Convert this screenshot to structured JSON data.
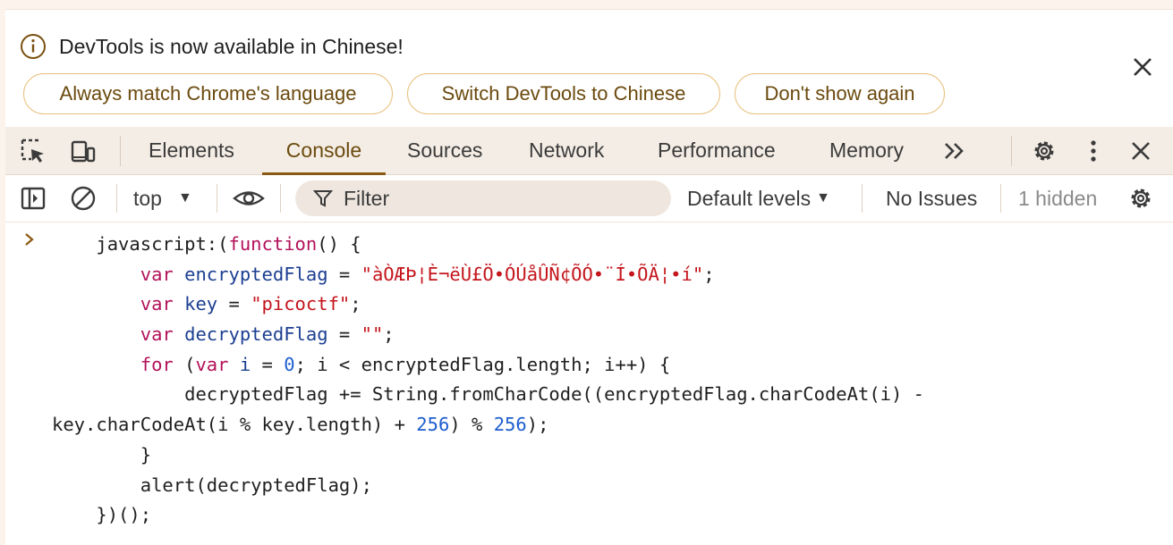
{
  "infobar": {
    "message": "DevTools is now available in Chinese!",
    "buttons": [
      "Always match Chrome's language",
      "Switch DevTools to Chinese",
      "Don't show again"
    ],
    "info_icon": "info-icon",
    "close_icon": "close-icon"
  },
  "tabbar": {
    "tabs": [
      "Elements",
      "Console",
      "Sources",
      "Network",
      "Performance",
      "Memory"
    ],
    "active_tab": "Console",
    "more_tabs_icon": "chevron-double-right-icon",
    "icons": [
      "inspect-element-icon",
      "device-toolbar-icon",
      "settings-gear-icon",
      "kebab-menu-icon",
      "close-icon"
    ]
  },
  "toolbar": {
    "context": "top",
    "filter_placeholder": "Filter",
    "levels": "Default levels",
    "issues": "No Issues",
    "hidden": "1 hidden",
    "icons": [
      "sidebar-toggle-icon",
      "clear-console-icon",
      "eye-icon",
      "filter-icon",
      "console-settings-gear-icon"
    ]
  },
  "console": {
    "prompt_icon": "chevron-right-icon",
    "code": {
      "l1_a": "javascript:(",
      "l1_kw": "function",
      "l1_b": "() {",
      "l2_kw": "var",
      "l2_var": "encryptedFlag",
      "l2_eq": " = ",
      "l2_str": "\"àÒÆÞ¦È¬ëÙ£Ö•ÓÚåÛÑ¢ÕÓ•¨Í•ÕÄ¦•í\"",
      "l2_end": ";",
      "l3_kw": "var",
      "l3_var": "key",
      "l3_eq": " = ",
      "l3_str": "\"picoctf\"",
      "l3_end": ";",
      "l4_kw": "var",
      "l4_var": "decryptedFlag",
      "l4_eq": " = ",
      "l4_str": "\"\"",
      "l4_end": ";",
      "l5_kw1": "for",
      "l5_a": " (",
      "l5_kw2": "var",
      "l5_var": "i",
      "l5_b": " = ",
      "l5_num": "0",
      "l5_c": "; i < encryptedFlag.length; i++) {",
      "l6": "decryptedFlag += String.fromCharCode((encryptedFlag.charCodeAt(i) -",
      "l7_a": "key.charCodeAt(i % key.length) + ",
      "l7_num1": "256",
      "l7_b": ") % ",
      "l7_num2": "256",
      "l7_c": ");",
      "l8": "}",
      "l9": "alert(decryptedFlag);",
      "l10": "})();"
    }
  },
  "colors": {
    "accent": "#8a5a12",
    "tab_active": "#6b4a0e",
    "tabbar_bg": "#f4ede5",
    "chip_border": "#e8c07d",
    "keyword": "#b3125a",
    "variable": "#1c3f91",
    "string": "#c4151c",
    "number": "#1e5ecf"
  }
}
